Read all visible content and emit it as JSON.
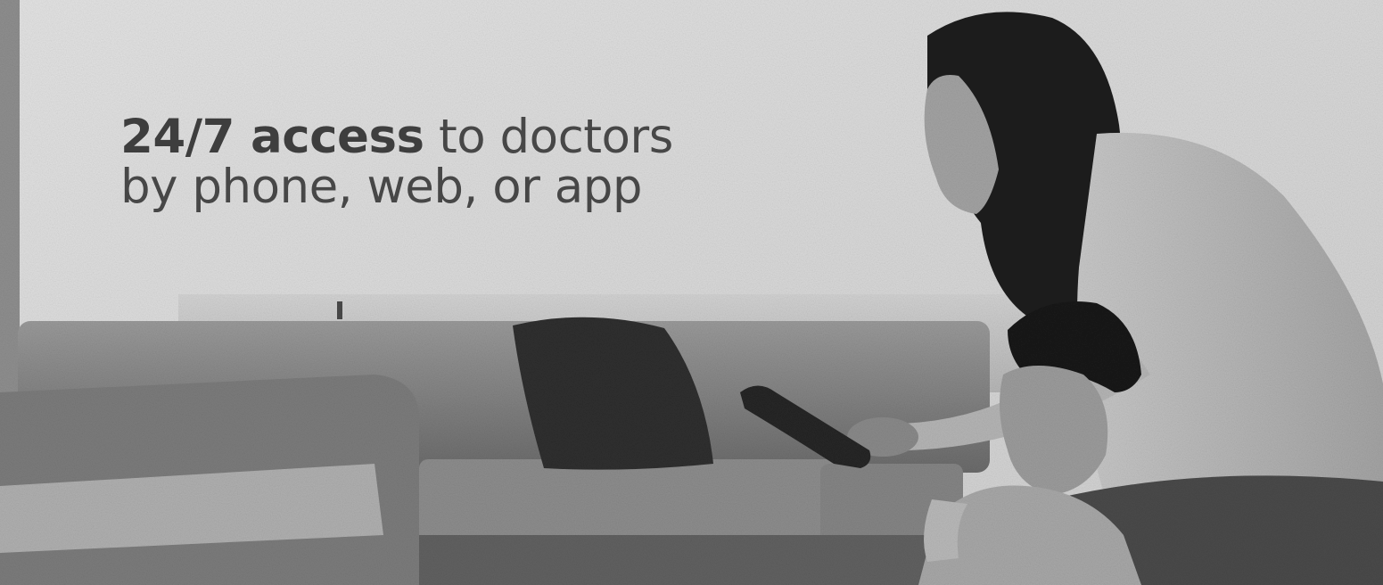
{
  "headline": {
    "bold": "24/7 access",
    "rest_line1": " to doctors",
    "line2": "by phone, web, or app"
  },
  "scene": {
    "description_icons": [
      "sofa",
      "cushion",
      "tablet",
      "woman",
      "child"
    ],
    "palette": {
      "bg": "#dcdcdc",
      "sofa": "#8a8a8a",
      "dark": "#2d2d2d",
      "hair": "#1e1e1e",
      "shirt": "#bdbdbd"
    }
  }
}
